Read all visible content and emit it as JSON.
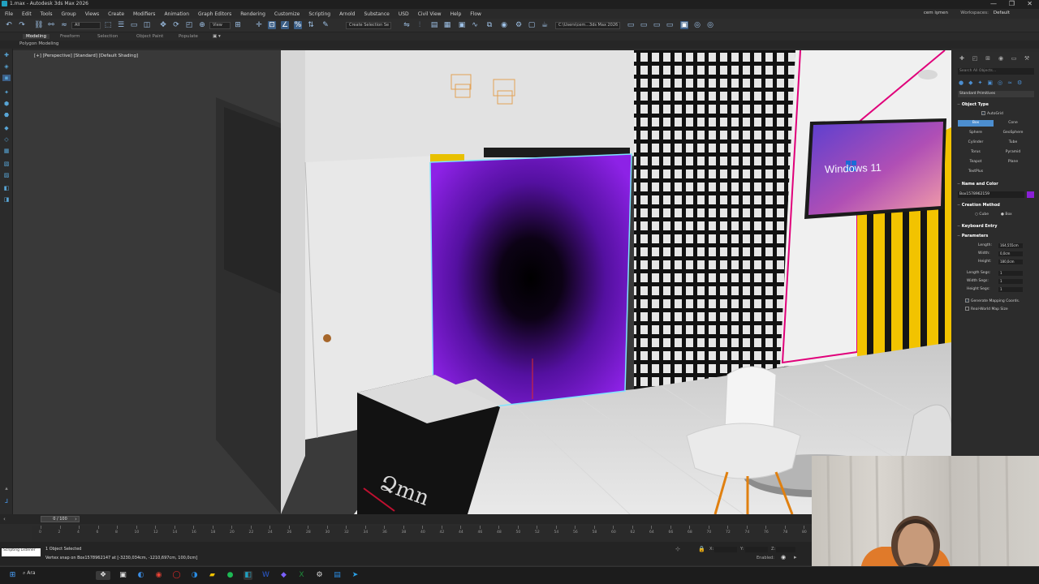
{
  "window": {
    "title": "1.max - Autodesk 3ds Max 2026",
    "controls": [
      "—",
      "❐",
      "✕"
    ]
  },
  "menu": {
    "items": [
      "File",
      "Edit",
      "Tools",
      "Group",
      "Views",
      "Create",
      "Modifiers",
      "Animation",
      "Graph Editors",
      "Rendering",
      "Customize",
      "Scripting",
      "Arnold",
      "Substance",
      "USD",
      "Civil View",
      "Help",
      "Flow"
    ],
    "user": "cem işmen",
    "workspaces_label": "Workspaces:",
    "workspaces_value": "Default"
  },
  "toolbar": {
    "filter_value": "All",
    "selection_set": "Create Selection Se",
    "path": "C:\\Users\\cem...3ds Max 2026",
    "view_mode": "View"
  },
  "ribbon": {
    "tabs": [
      "Modeling",
      "Freeform",
      "Selection",
      "Object Paint",
      "Populate"
    ],
    "active_tab": "Modeling",
    "sub": "Polygon Modeling"
  },
  "viewport": {
    "label": "[+] [Perspective] [Standard] [Default Shading]",
    "tv_text": "Windows 11",
    "accent_yellow": "#f2c300",
    "accent_pink": "#e0007a",
    "accent_purple": "#8a1fd6"
  },
  "command_panel": {
    "search_placeholder": "Search All Objects...",
    "category": "Standard Primitives",
    "object_type_title": "Object Type",
    "autogrid": "AutoGrid",
    "primitives": [
      "Box",
      "Cone",
      "Sphere",
      "GeoSphere",
      "Cylinder",
      "Tube",
      "Torus",
      "Pyramid",
      "Teapot",
      "Plane",
      "TextPlus"
    ],
    "selected_primitive": "Box",
    "name_color_title": "Name and Color",
    "object_name": "Box1578962159",
    "object_color": "#8a1fd6",
    "creation_method_title": "Creation Method",
    "creation_options": [
      "Cube",
      "Box"
    ],
    "keyboard_entry_title": "Keyboard Entry",
    "parameters_title": "Parameters",
    "params": [
      {
        "label": "Length:",
        "value": "164,555cm"
      },
      {
        "label": "Width:",
        "value": "0,0cm"
      },
      {
        "label": "Height:",
        "value": "180,0cm"
      },
      {
        "label": "Length Segs:",
        "value": "1"
      },
      {
        "label": "Width Segs:",
        "value": "1"
      },
      {
        "label": "Height Segs:",
        "value": "1"
      }
    ],
    "generate_mapping": "Generate Mapping Coords.",
    "real_world": "Real-World Map Size"
  },
  "timeline": {
    "frame_display": "0 / 100",
    "ticks": [
      0,
      2,
      4,
      6,
      8,
      10,
      12,
      14,
      16,
      18,
      20,
      22,
      24,
      26,
      28,
      30,
      32,
      34,
      36,
      38,
      40,
      42,
      44,
      46,
      48,
      50,
      52,
      54,
      56,
      58,
      60,
      62,
      64,
      66,
      68,
      70,
      72,
      74,
      76,
      78,
      80
    ]
  },
  "status": {
    "selection": "1 Object Selected",
    "prompt": "Vertex snap on Box1578962147 at [-3230,034cm, -1210,697cm, 100,0cm]",
    "maxscript": "Scripting Listener",
    "x": "X:",
    "y": "Y:",
    "z": "Z:",
    "enabled": "Enabled:"
  },
  "taskbar": {
    "search": "Ara"
  }
}
